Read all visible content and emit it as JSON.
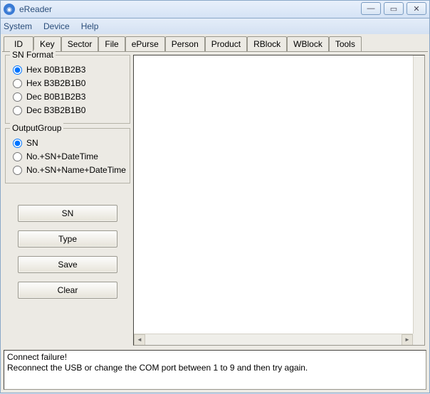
{
  "window": {
    "title": "eReader"
  },
  "menu": {
    "system": "System",
    "device": "Device",
    "help": "Help"
  },
  "tabs": [
    "ID",
    "Key",
    "Sector",
    "File",
    "ePurse",
    "Person",
    "Product",
    "RBlock",
    "WBlock",
    "Tools"
  ],
  "active_tab": 0,
  "sn_format": {
    "legend": "SN Format",
    "options": [
      "Hex B0B1B2B3",
      "Hex B3B2B1B0",
      "Dec B0B1B2B3",
      "Dec B3B2B1B0"
    ],
    "selected": 0
  },
  "output_group": {
    "legend": "OutputGroup",
    "options": [
      "SN",
      "No.+SN+DateTime",
      "No.+SN+Name+DateTime"
    ],
    "selected": 0
  },
  "buttons": {
    "sn": "SN",
    "type": "Type",
    "save": "Save",
    "clear": "Clear"
  },
  "status": {
    "line1": "Connect failure!",
    "line2": "Reconnect the USB or change the COM port between 1 to 9 and then try again."
  }
}
